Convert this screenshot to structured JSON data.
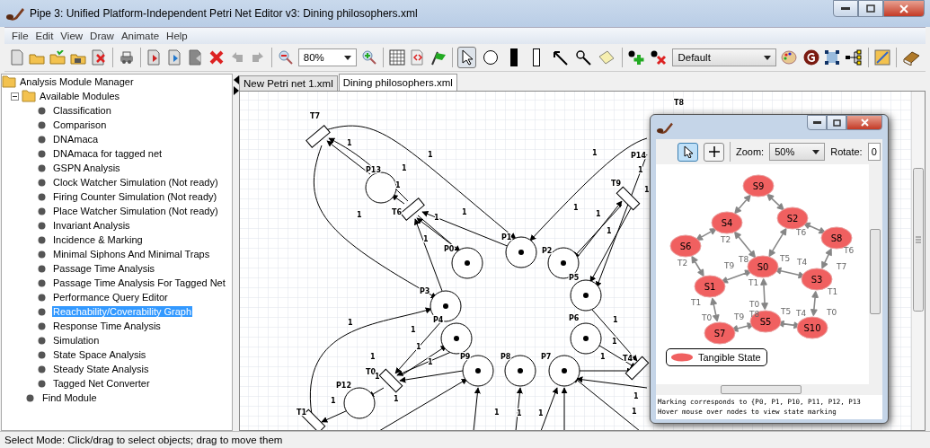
{
  "window": {
    "title": "Pipe 3: Unified Platform-Independent Petri Net Editor v3: Dining philosophers.xml"
  },
  "menu": [
    "File",
    "Edit",
    "View",
    "Draw",
    "Animate",
    "Help"
  ],
  "toolbar": {
    "zoom": "80%",
    "token_class": "Default",
    "tools": [
      {
        "kind": "select",
        "selected": true
      },
      {
        "kind": "place",
        "selected": false
      },
      {
        "kind": "immediate-transition",
        "selected": false
      },
      {
        "kind": "timed-transition",
        "selected": false
      },
      {
        "kind": "arc",
        "selected": false
      },
      {
        "kind": "inhibitor-arc",
        "selected": false
      },
      {
        "kind": "annotation",
        "selected": false
      }
    ]
  },
  "tree": {
    "label": "Analysis Module Manager",
    "children": [
      {
        "label": "Available Modules",
        "expanded": true,
        "children": [
          {
            "label": "Classification",
            "selected": false
          },
          {
            "label": "Comparison",
            "selected": false
          },
          {
            "label": "DNAmaca",
            "selected": false
          },
          {
            "label": "DNAmaca for tagged net",
            "selected": false
          },
          {
            "label": "GSPN Analysis",
            "selected": false
          },
          {
            "label": "Clock Watcher Simulation (Not ready)",
            "selected": false
          },
          {
            "label": "Firing Counter Simulation (Not ready)",
            "selected": false
          },
          {
            "label": "Place Watcher Simulation (Not ready)",
            "selected": false
          },
          {
            "label": "Invariant Analysis",
            "selected": false
          },
          {
            "label": "Incidence & Marking",
            "selected": false
          },
          {
            "label": "Minimal Siphons And Minimal Traps",
            "selected": false
          },
          {
            "label": "Passage Time Analysis",
            "selected": false
          },
          {
            "label": "Passage Time Analysis For Tagged Net",
            "selected": false
          },
          {
            "label": "Performance Query Editor",
            "selected": false
          },
          {
            "label": "Reachability/Coverability Graph",
            "selected": true
          },
          {
            "label": "Response Time Analysis",
            "selected": false
          },
          {
            "label": "Simulation",
            "selected": false
          },
          {
            "label": "State Space Analysis",
            "selected": false
          },
          {
            "label": "Steady State Analysis",
            "selected": false
          },
          {
            "label": "Tagged Net Converter",
            "selected": false
          }
        ]
      },
      {
        "label": "Find Module"
      }
    ]
  },
  "tabs": [
    {
      "label": "New Petri net 1.xml",
      "selected": false
    },
    {
      "label": "Dining philosophers.xml",
      "selected": true
    }
  ],
  "net": {
    "places": [
      {
        "label": "P13",
        "marked": false
      },
      {
        "label": "P0",
        "marked": true
      },
      {
        "label": "P1",
        "marked": true
      },
      {
        "label": "P2",
        "marked": true
      },
      {
        "label": "P5",
        "marked": true
      },
      {
        "label": "P3",
        "marked": true
      },
      {
        "label": "P6",
        "marked": true
      },
      {
        "label": "P4",
        "marked": true
      },
      {
        "label": "P9",
        "marked": true
      },
      {
        "label": "P8",
        "marked": true
      },
      {
        "label": "P7",
        "marked": true
      },
      {
        "label": "P12",
        "marked": false
      },
      {
        "label": "P14"
      }
    ],
    "transitions": [
      {
        "label": "T7"
      },
      {
        "label": "T6"
      },
      {
        "label": "T9"
      },
      {
        "label": "T0"
      },
      {
        "label": "T1"
      },
      {
        "label": "T4"
      },
      {
        "label": "T8"
      }
    ],
    "arc_weights": [
      "1",
      "1",
      "1",
      "1",
      "1",
      "1",
      "1",
      "1",
      "1",
      "1",
      "1",
      "1",
      "1",
      "1",
      "1",
      "1",
      "1",
      "1",
      "1",
      "1",
      "1",
      "1",
      "1",
      "1",
      "1",
      "1",
      "1",
      "1",
      "1",
      "1"
    ]
  },
  "graph_window": {
    "zoom_label": "Zoom:",
    "zoom": "50%",
    "rotate_label": "Rotate:",
    "rotate": "0",
    "pointer_selected": true,
    "states": [
      {
        "label": "S9"
      },
      {
        "label": "S4"
      },
      {
        "label": "S2"
      },
      {
        "label": "S6"
      },
      {
        "label": "S8"
      },
      {
        "label": "S0"
      },
      {
        "label": "S1"
      },
      {
        "label": "S3"
      },
      {
        "label": "S5"
      },
      {
        "label": "S7"
      },
      {
        "label": "S10"
      }
    ],
    "edge_labels": [
      "T9",
      "T8",
      "T5",
      "T4",
      "T7",
      "T1",
      "T1",
      "T1",
      "T0",
      "T8",
      "T5",
      "T4",
      "T0",
      "T0",
      "T9",
      "T6",
      "T6",
      "T2",
      "T2"
    ],
    "legend": "Tangible State",
    "output": [
      "Marking corresponds to {P0, P1, P10, P11, P12, P13",
      "Hover mouse over nodes to view state marking"
    ]
  },
  "status_bar": "Select Mode: Click/drag to select objects; drag to move them"
}
